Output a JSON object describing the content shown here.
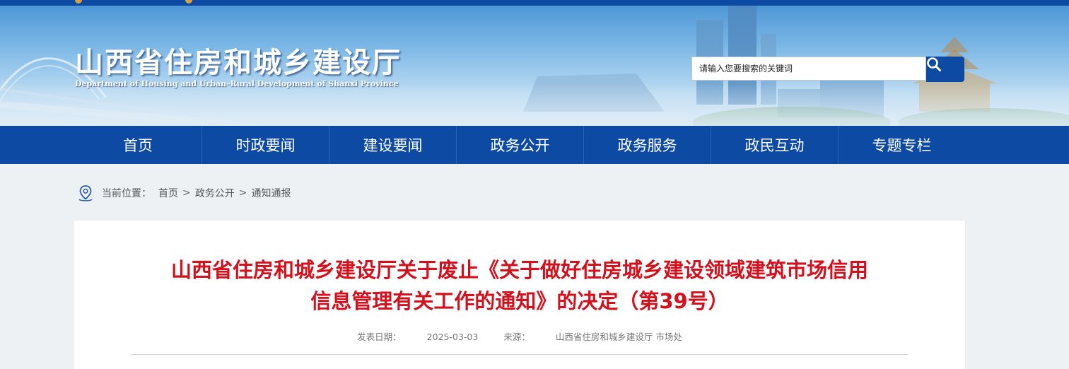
{
  "header": {
    "site_title": "山西省住房和城乡建设厅",
    "site_subtitle": "Department of Housing and Urban–Rural Development of Shanxi Province"
  },
  "search": {
    "placeholder": "请输入您要搜索的关键词",
    "button_icon": "search-icon"
  },
  "nav": {
    "items": [
      {
        "label": "首页"
      },
      {
        "label": "时政要闻"
      },
      {
        "label": "建设要闻"
      },
      {
        "label": "政务公开"
      },
      {
        "label": "政务服务"
      },
      {
        "label": "政民互动"
      },
      {
        "label": "专题专栏"
      }
    ]
  },
  "breadcrumb": {
    "icon": "location-pin-icon",
    "prefix": "当前位置：",
    "items": [
      "首页",
      "政务公开",
      "通知通报"
    ],
    "separator": ">"
  },
  "article": {
    "title_line1": "山西省住房和城乡建设厅关于废止《关于做好住房城乡建设领域建筑市场信用",
    "title_line2": "信息管理有关工作的通知》的决定（第39号）",
    "publish_label": "发表日期：",
    "publish_date": "2025-03-03",
    "source_label": "来源：",
    "source": "山西省住房和城乡建设厅 市场处"
  },
  "colors": {
    "brand_blue": "#0d4aa3",
    "title_red": "#d4101c"
  }
}
